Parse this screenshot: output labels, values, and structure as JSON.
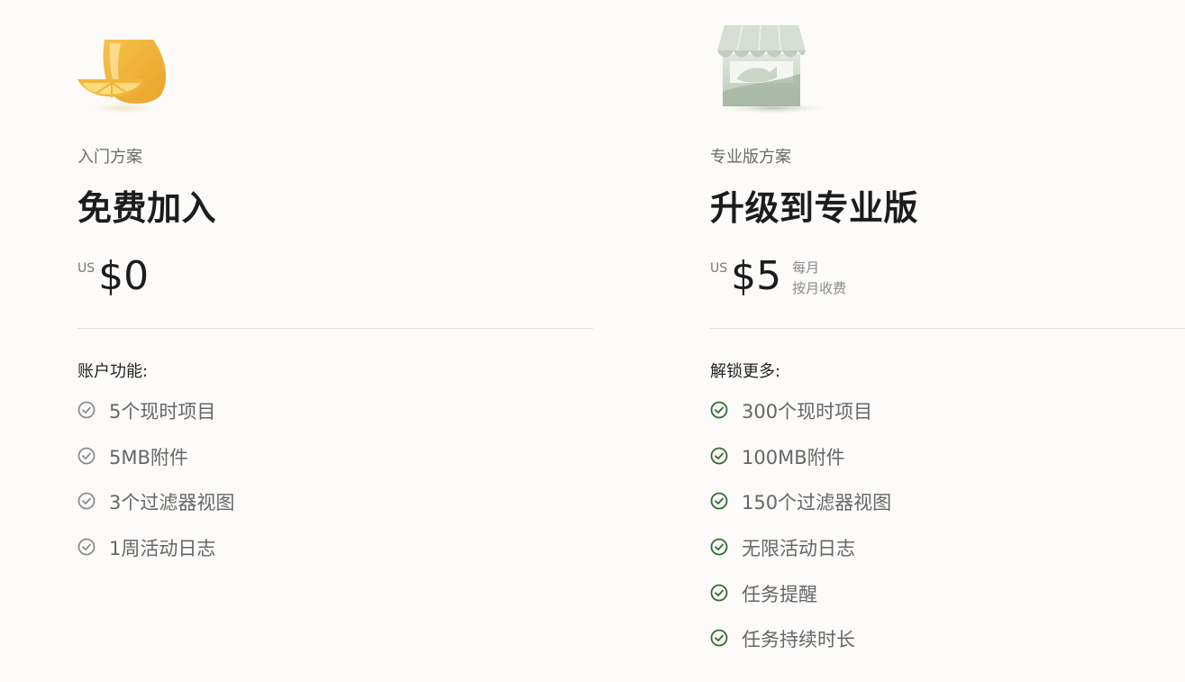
{
  "plans": {
    "free": {
      "illustration": "lemon-drink-icon",
      "kicker": "入门方案",
      "title": "免费加入",
      "currency": "US",
      "amount": "$0",
      "features_heading": "账户功能:",
      "check_color": "#8c8c8c",
      "features": [
        "5个现时项目",
        "5MB附件",
        "3个过滤器视图",
        "1周活动日志"
      ]
    },
    "pro": {
      "illustration": "storefront-icon",
      "kicker": "专业版方案",
      "title": "升级到专业版",
      "currency": "US",
      "amount": "$5",
      "billing_period": "每月",
      "billing_note": "按月收费",
      "features_heading": "解锁更多:",
      "check_color": "#2f6b2f",
      "features": [
        "300个现时项目",
        "100MB附件",
        "150个过滤器视图",
        "无限活动日志",
        "任务提醒",
        "任务持续时长"
      ]
    }
  }
}
